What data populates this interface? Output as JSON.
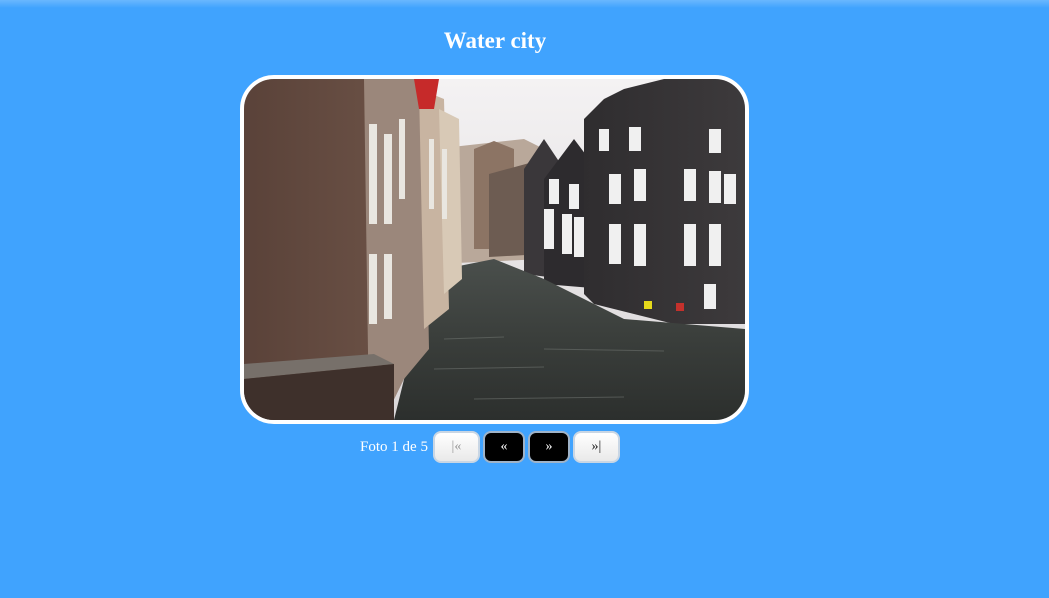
{
  "gallery": {
    "title": "Water city",
    "photo_alt": "Amsterdam canal with brick buildings",
    "counter": {
      "prefix": "Foto",
      "current": 1,
      "separator": "de",
      "total": 5
    }
  },
  "pager": {
    "first_label": "|«",
    "prev_label": "«",
    "next_label": "»",
    "last_label": "»|"
  },
  "colors": {
    "background": "#40a3fe",
    "frame_border": "#ffffff",
    "dark_button": "#000000"
  }
}
